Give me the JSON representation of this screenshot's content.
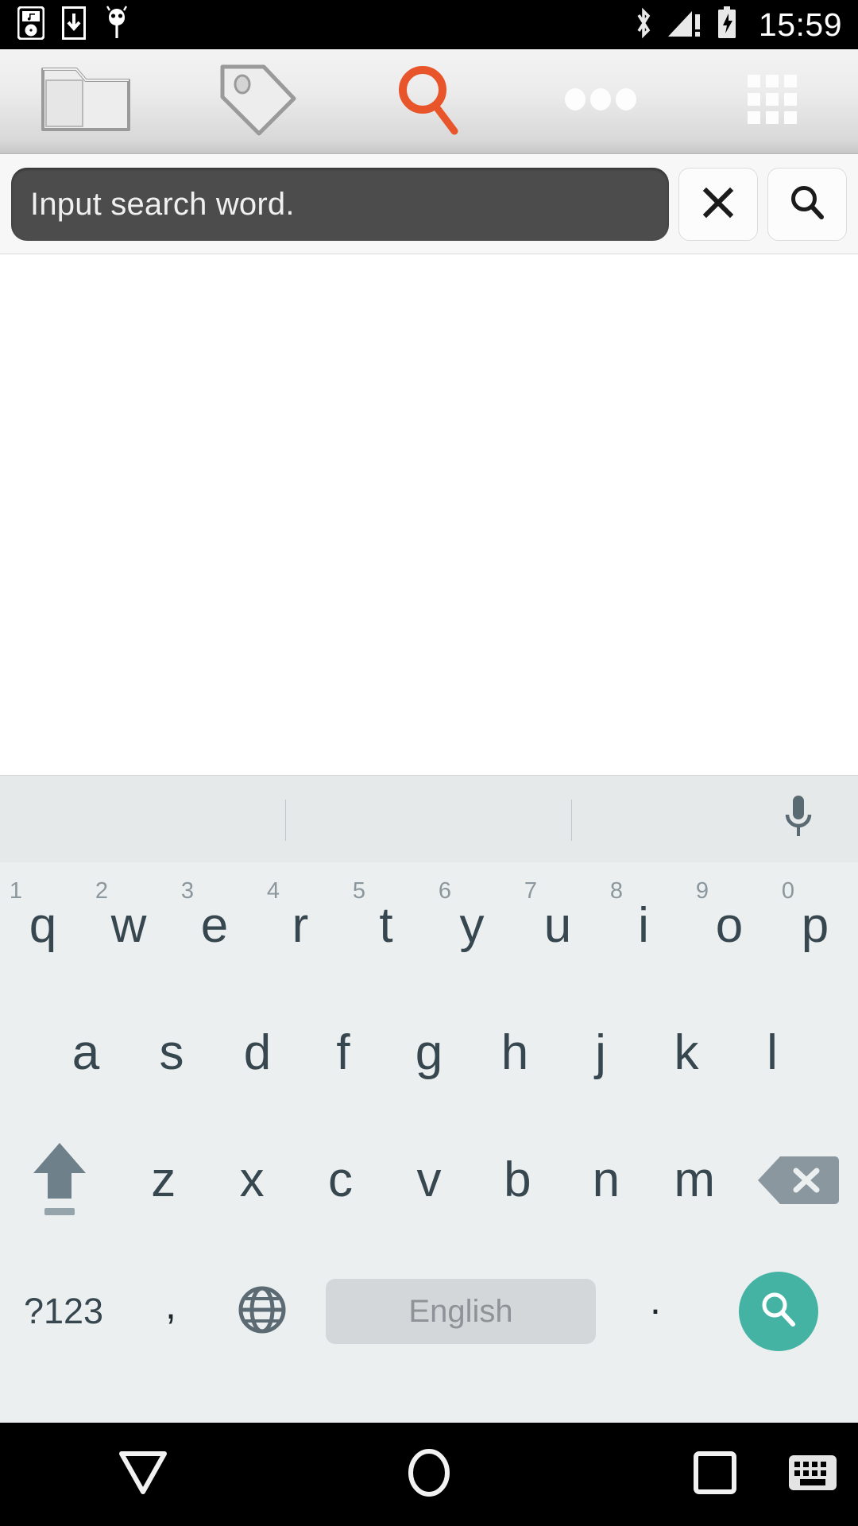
{
  "status_bar": {
    "clock": "15:59",
    "left_icons": [
      {
        "name": "music-player-icon",
        "label": "music player"
      },
      {
        "name": "download-icon",
        "label": "download"
      },
      {
        "name": "android-bug-icon",
        "label": "android bug"
      }
    ],
    "right_icons": [
      {
        "name": "bluetooth-icon",
        "label": "bluetooth"
      },
      {
        "name": "signal-warning-icon",
        "label": "no service"
      },
      {
        "name": "battery-charging-icon",
        "label": "battery charging"
      }
    ]
  },
  "toolbar": {
    "items": [
      {
        "name": "folder-icon",
        "label": "Folder",
        "active": false
      },
      {
        "name": "tag-icon",
        "label": "Tag",
        "active": false
      },
      {
        "name": "search-icon",
        "label": "Search",
        "active": true
      },
      {
        "name": "overflow-icon",
        "label": "More",
        "active": false
      },
      {
        "name": "grid-icon",
        "label": "Grid",
        "active": false
      }
    ],
    "accent_color": "#e8552a"
  },
  "search": {
    "placeholder": "Input search word.",
    "value": "",
    "clear_label": "×",
    "submit_label": "Search",
    "field_bg": "#4c4c4c"
  },
  "keyboard": {
    "suggestions": [
      "",
      "",
      ""
    ],
    "mic_label": "Voice input",
    "rows": {
      "row1": [
        {
          "key": "q",
          "num": "1"
        },
        {
          "key": "w",
          "num": "2"
        },
        {
          "key": "e",
          "num": "3"
        },
        {
          "key": "r",
          "num": "4"
        },
        {
          "key": "t",
          "num": "5"
        },
        {
          "key": "y",
          "num": "6"
        },
        {
          "key": "u",
          "num": "7"
        },
        {
          "key": "i",
          "num": "8"
        },
        {
          "key": "o",
          "num": "9"
        },
        {
          "key": "p",
          "num": "0"
        }
      ],
      "row2": [
        {
          "key": "a"
        },
        {
          "key": "s"
        },
        {
          "key": "d"
        },
        {
          "key": "f"
        },
        {
          "key": "g"
        },
        {
          "key": "h"
        },
        {
          "key": "j"
        },
        {
          "key": "k"
        },
        {
          "key": "l"
        }
      ],
      "row3": [
        {
          "key": "z"
        },
        {
          "key": "x"
        },
        {
          "key": "c"
        },
        {
          "key": "v"
        },
        {
          "key": "b"
        },
        {
          "key": "n"
        },
        {
          "key": "m"
        }
      ],
      "row4": {
        "symbols": "?123",
        "comma": ",",
        "space": "English",
        "period": ".",
        "enter": "search"
      }
    },
    "shift_label": "Shift",
    "delete_label": "Delete",
    "globe_label": "Change language",
    "enter_color": "#45b3a3",
    "bg_color": "#eceff0",
    "key_text_color": "#37474f"
  },
  "nav_bar": {
    "back_label": "Back",
    "home_label": "Home",
    "recents_label": "Recents",
    "keyboard_label": "Keyboard"
  }
}
